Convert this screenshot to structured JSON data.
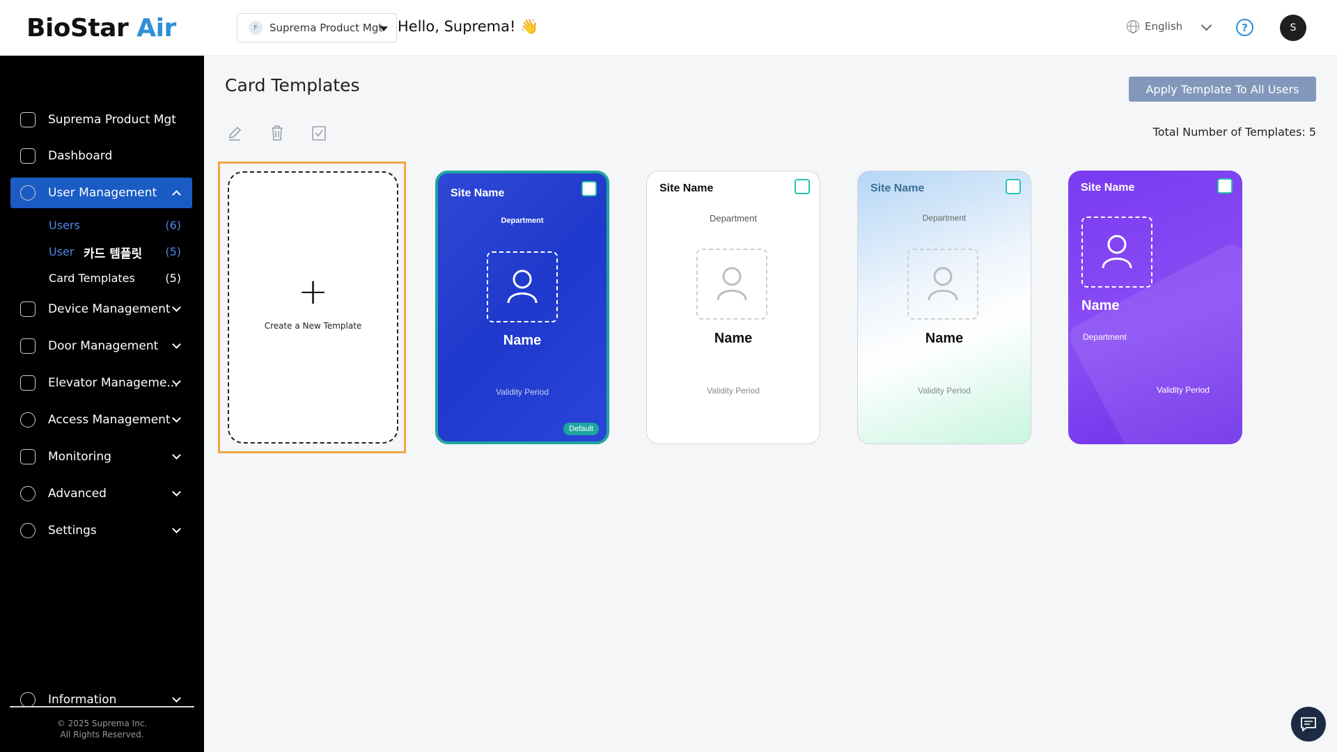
{
  "header": {
    "logo_main": "BioStar",
    "logo_accent": "Air",
    "site_badge": "F",
    "site_name": "Suprema Product Mgt",
    "greeting": "Hello, Suprema! 👋",
    "language": "English",
    "avatar_initial": "S"
  },
  "sidebar": {
    "site": "Suprema Product Mgt",
    "dashboard": "Dashboard",
    "user_management": "User Management",
    "sub": [
      {
        "label": "Users",
        "count": "(6)"
      },
      {
        "label": "User ",
        "count": "(5)"
      },
      {
        "label": "Card Templates",
        "count": "(5)"
      }
    ],
    "tooltip": "카드 템플릿",
    "device_management": "Device Management",
    "door_management": "Door Management",
    "elevator_management": "Elevator Manageme...",
    "access_management": "Access Management",
    "monitoring": "Monitoring",
    "advanced": "Advanced",
    "settings": "Settings",
    "information": "Information",
    "copyright_1": "© 2025 Suprema Inc.",
    "copyright_2": "All Rights Reserved."
  },
  "main": {
    "title": "Card Templates",
    "apply_button": "Apply Template To All Users",
    "total": "Total Number of Templates: 5",
    "new_template": "Create a New Template"
  },
  "cards": [
    {
      "site": "Site Name",
      "department": "Department",
      "name": "Name",
      "validity": "Validity Period",
      "badge": "Default"
    },
    {
      "site": "Site Name",
      "department": "Department",
      "name": "Name",
      "validity": "Validity Period"
    },
    {
      "site": "Site Name",
      "department": "Department",
      "name": "Name",
      "validity": "Validity Period"
    },
    {
      "site": "Site Name",
      "department": "Department",
      "name": "Name",
      "validity": "Validity Period"
    }
  ],
  "colors": {
    "accent_blue": "#1b5bc4",
    "logo_accent": "#2f8fd8",
    "apply_button": "#8297ba",
    "selected_frame": "#f0a644",
    "default_badge": "#1fa69e"
  },
  "icons": [
    "globe-icon",
    "help-icon",
    "building-icon",
    "dashboard-icon",
    "user-icon",
    "device-icon",
    "door-icon",
    "elevator-icon",
    "key-icon",
    "monitoring-icon",
    "advanced-icon",
    "gear-icon",
    "info-icon",
    "edit-icon",
    "trash-icon",
    "checkbox-icon",
    "plus-icon",
    "chat-icon"
  ]
}
